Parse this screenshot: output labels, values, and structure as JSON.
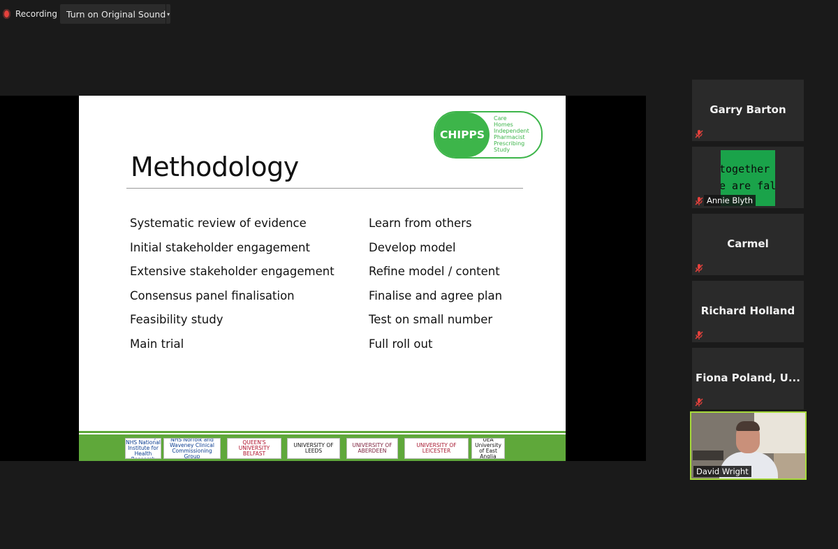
{
  "topbar": {
    "recording_label": "Recording",
    "sound_button_label": "Turn on Original Sound",
    "dropdown_glyph": "▾"
  },
  "slide": {
    "logo": {
      "abbrev": "CHIPPS",
      "lines": [
        "Care",
        "Homes",
        "Independent",
        "Pharmacist",
        "Prescribing",
        "Study"
      ]
    },
    "title": "Methodology",
    "left_items": [
      "Systematic review of evidence",
      "Initial stakeholder engagement",
      "Extensive stakeholder engagement",
      "Consensus panel finalisation",
      "Feasibility study",
      "Main trial"
    ],
    "right_items": [
      "Learn from others",
      "Develop model",
      "Refine model / content",
      "Finalise and agree plan",
      "Test on small number",
      "Full roll out"
    ],
    "footer_logos": [
      {
        "text": "Funded by NHS National Institute for Health Research"
      },
      {
        "text": "NHS Norfolk and Waveney Clinical Commissioning Group"
      },
      {
        "text": "QUEEN'S UNIVERSITY BELFAST"
      },
      {
        "text": "UNIVERSITY OF LEEDS"
      },
      {
        "text": "UNIVERSITY OF ABERDEEN"
      },
      {
        "text": "UNIVERSITY OF LEICESTER"
      },
      {
        "text": "UEA University of East Anglia"
      }
    ]
  },
  "participants": [
    {
      "name": "Garry Barton",
      "muted": true
    },
    {
      "name": "Annie Blyth",
      "muted": true,
      "thumbnail_text": [
        "together",
        "e are fal"
      ]
    },
    {
      "name": "Carmel",
      "muted": true
    },
    {
      "name": "Richard Holland",
      "muted": true
    },
    {
      "name": "Fiona Poland, U...",
      "muted": true
    },
    {
      "name": "David Wright",
      "video": true
    }
  ],
  "colors": {
    "accent_green": "#3db54a",
    "footer_green": "#5fa83a",
    "recording_red": "#e5413c",
    "active_speaker_border": "#a6d93a"
  },
  "icons": {
    "mute": "mic-muted-icon",
    "record": "record-icon"
  }
}
